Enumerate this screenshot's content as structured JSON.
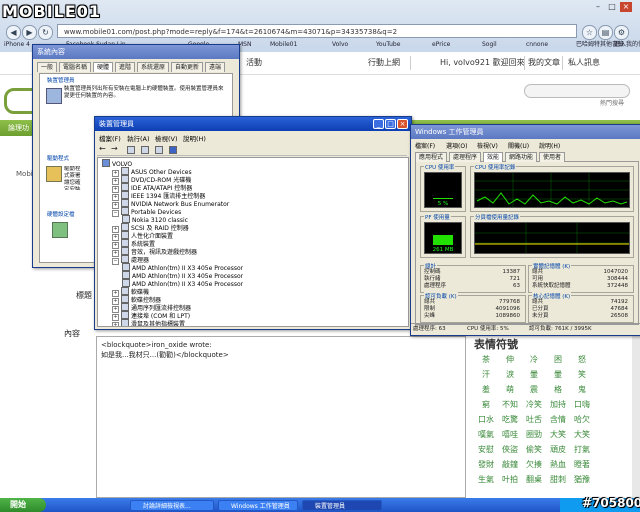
{
  "watermark": "MOBILE01",
  "browser": {
    "address": "www.mobile01.com/post.php?mode=reply&f=174&t=2610674&m=43071&p=34335738&q=2",
    "bookmarks": [
      "iPhone 4",
      "Facebook Sudan Lin",
      "Google",
      "MSN",
      "Mobile01",
      "Volvo",
      "YouTube",
      "ePrice",
      "Sogil",
      "cnnone",
      "巴哈姆特",
      "進入我的信箱",
      "其他書籤"
    ]
  },
  "site": {
    "top_links": [
      "行動上網",
      "Hi, volvo921 歡迎回來",
      "我的文章",
      "私人訊息"
    ],
    "title_partial": "活動",
    "search_hint": "熱門搜尋",
    "nav": [
      "論理功"
    ],
    "left_labels": {
      "mobile": "Mobile",
      "biaoti": "標題",
      "neirong": "內容"
    },
    "quote_text": "<blockquote>iron_oxide wrote:",
    "quote_text2": "如是我...我材只...(勸勸)</blockquote>",
    "emotion_title": "表情符號",
    "emotion_words": [
      "茶",
      "伸",
      "冷",
      "困",
      "怒",
      "汗",
      "淚",
      "暈",
      "暈",
      "笑",
      "羞",
      "萌",
      "震",
      "格",
      "鬼",
      "窮",
      "不知",
      "冷笑",
      "加持",
      "口嗨",
      "口水",
      "吃驚",
      "吐舌",
      "含情",
      "哈欠",
      "嘆氣",
      "嘻哇",
      "圈勁",
      "大笑",
      "大笑",
      "安慰",
      "俠盜",
      "偷笑",
      "頑皮",
      "打氣",
      "發財",
      "敲鐘",
      "欠揍",
      "熱血",
      "瞪著",
      "生氣",
      "叶拍",
      "翻桌",
      "甜刺",
      "猶豫"
    ]
  },
  "sys_props": {
    "title": "系統內容",
    "tabs": [
      "一般",
      "電腦名稱",
      "硬體",
      "進階",
      "系統還原",
      "自動更新",
      "遠端"
    ],
    "section1": "裝置管理員",
    "desc1": "裝置管理員列出所有安裝在電腦上的硬體裝置。使用裝置管理員來變更任何裝置的內容。",
    "section2": "驅動程式",
    "desc2": "驅動程式簽署讓您確定安裝的驅動程式與 Windows 相容。",
    "section3": "硬體設定檔"
  },
  "devmgr": {
    "title": "裝置管理員",
    "menu": [
      "檔案(F)",
      "執行(A)",
      "檢視(V)",
      "說明(H)"
    ],
    "tree": [
      {
        "label": "VOLVO",
        "level": 0
      },
      {
        "label": "ASUS Other Devices",
        "level": 1
      },
      {
        "label": "DVD/CD-ROM 光碟機",
        "level": 1
      },
      {
        "label": "IDE ATA/ATAPI 控制器",
        "level": 1
      },
      {
        "label": "IEEE 1394 匯流排主控制器",
        "level": 1
      },
      {
        "label": "NVIDIA Network Bus Enumerator",
        "level": 1
      },
      {
        "label": "Portable Devices",
        "level": 1
      },
      {
        "label": "Nokia 3120 classic",
        "level": 2
      },
      {
        "label": "SCSI 及 RAID 控制器",
        "level": 1
      },
      {
        "label": "人性化介面裝置",
        "level": 1
      },
      {
        "label": "系統裝置",
        "level": 1
      },
      {
        "label": "音效，視訊及遊戲控制器",
        "level": 1
      },
      {
        "label": "處理器",
        "level": 1
      },
      {
        "label": "AMD Athlon(tm) II X3 405e Processor",
        "level": 2
      },
      {
        "label": "AMD Athlon(tm) II X3 405e Processor",
        "level": 2
      },
      {
        "label": "AMD Athlon(tm) II X3 405e Processor",
        "level": 2
      },
      {
        "label": "軟碟機",
        "level": 1
      },
      {
        "label": "軟碟控制器",
        "level": 1
      },
      {
        "label": "通用序列匯流排控制器",
        "level": 1
      },
      {
        "label": "連接埠 (COM 和 LPT)",
        "level": 1
      },
      {
        "label": "滑鼠及其他指標裝置",
        "level": 1
      }
    ]
  },
  "taskmgr": {
    "title": "Windows 工作管理員",
    "menu": [
      "檔案(F)",
      "選項(O)",
      "檢視(V)",
      "關機(U)",
      "說明(H)"
    ],
    "tabs": [
      "應用程式",
      "處理程序",
      "效能",
      "網路功能",
      "使用者"
    ],
    "cpu_usage_label": "CPU 使用率",
    "cpu_usage_value": "5 %",
    "cpu_hist_label": "CPU 使用率記錄",
    "pf_label": "PF 使用量",
    "pf_value": "261 MB",
    "pf_hist_label": "分頁檔使用量記錄",
    "totals_label": "總計",
    "totals": [
      [
        "控制碼",
        "13387"
      ],
      [
        "執行緒",
        "721"
      ],
      [
        "處理程序",
        "63"
      ]
    ],
    "commit_label": "實體記憶體 (K)",
    "commit": [
      [
        "總共",
        "1047020"
      ],
      [
        "可用",
        "308444"
      ],
      [
        "系統快取記憶體",
        "372448"
      ]
    ],
    "commit2_label": "認可負載 (K)",
    "commit2": [
      [
        "總共",
        "779768"
      ],
      [
        "限制",
        "4091096"
      ],
      [
        "尖峰",
        "1089860"
      ]
    ],
    "kernel_label": "核心記憶體 (K)",
    "kernel": [
      [
        "總共",
        "74192"
      ],
      [
        "已分頁",
        "47684"
      ],
      [
        "未分頁",
        "26508"
      ]
    ],
    "status": [
      "處理程序: 63",
      "CPU 使用率: 5%",
      "認可負載: 761K / 3995K"
    ],
    "cpu_percent": 5
  },
  "taskbar": {
    "start": "開始",
    "tasks": [
      "討論詳細檢視表...",
      "Windows 工作管理員",
      "裝置管理員"
    ],
    "counter": "#705800"
  }
}
